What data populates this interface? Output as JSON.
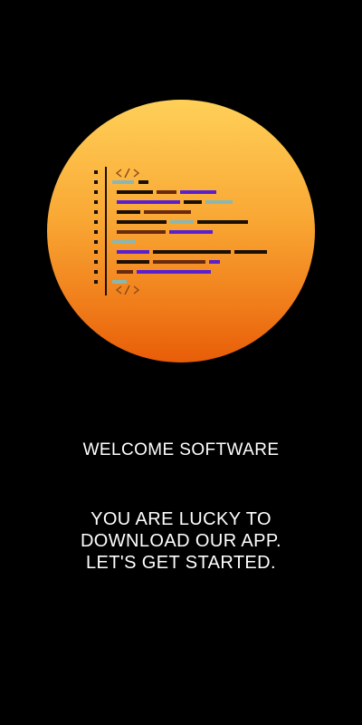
{
  "screen": {
    "background_color": "#000000",
    "accent_gradient": [
      "#ffd058",
      "#f9a834",
      "#f07d1a",
      "#e85d08"
    ]
  },
  "hero": {
    "icon": "code-editor-illustration",
    "colors": {
      "dark": "#1a0e05",
      "brown": "#6b2a10",
      "purple": "#5a1fd1",
      "teal": "#8ab7b3",
      "bracket": "#8a4a1a"
    }
  },
  "welcome": {
    "title": "WELCOME SOFTWARE",
    "subtitle_lines": [
      "YOU ARE LUCKY TO",
      "DOWNLOAD OUR APP.",
      "LET'S GET STARTED."
    ]
  }
}
